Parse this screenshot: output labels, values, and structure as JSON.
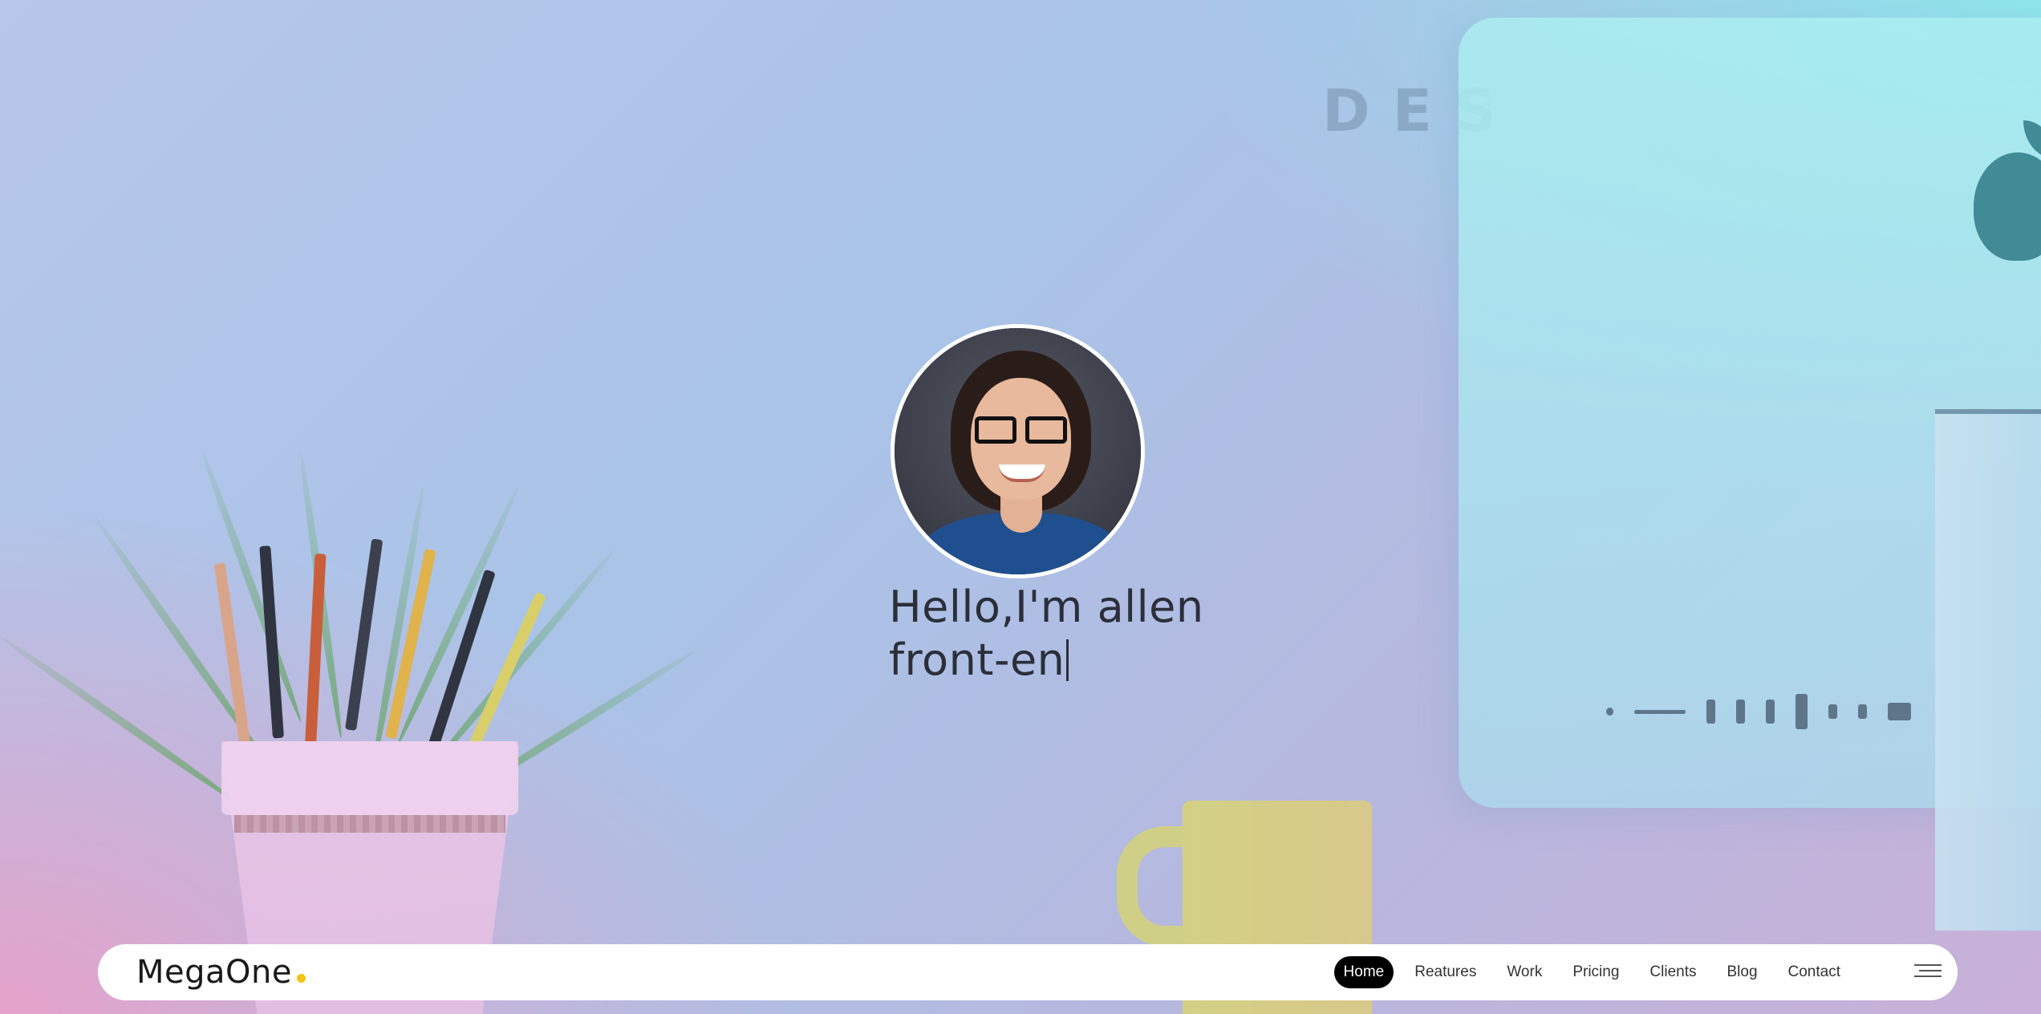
{
  "hero": {
    "background_word": "DES",
    "greeting_line1": "Hello,I'm allen",
    "greeting_line2": "front-en"
  },
  "navbar": {
    "logo": "MegaOne",
    "logo_dot_color": "#f2c40f",
    "links": [
      {
        "label": "Home",
        "active": true
      },
      {
        "label": "Reatures",
        "active": false
      },
      {
        "label": "Work",
        "active": false
      },
      {
        "label": "Pricing",
        "active": false
      },
      {
        "label": "Clients",
        "active": false
      },
      {
        "label": "Blog",
        "active": false
      },
      {
        "label": "Contact",
        "active": false
      }
    ],
    "menu_icon": "hamburger-menu-icon"
  }
}
